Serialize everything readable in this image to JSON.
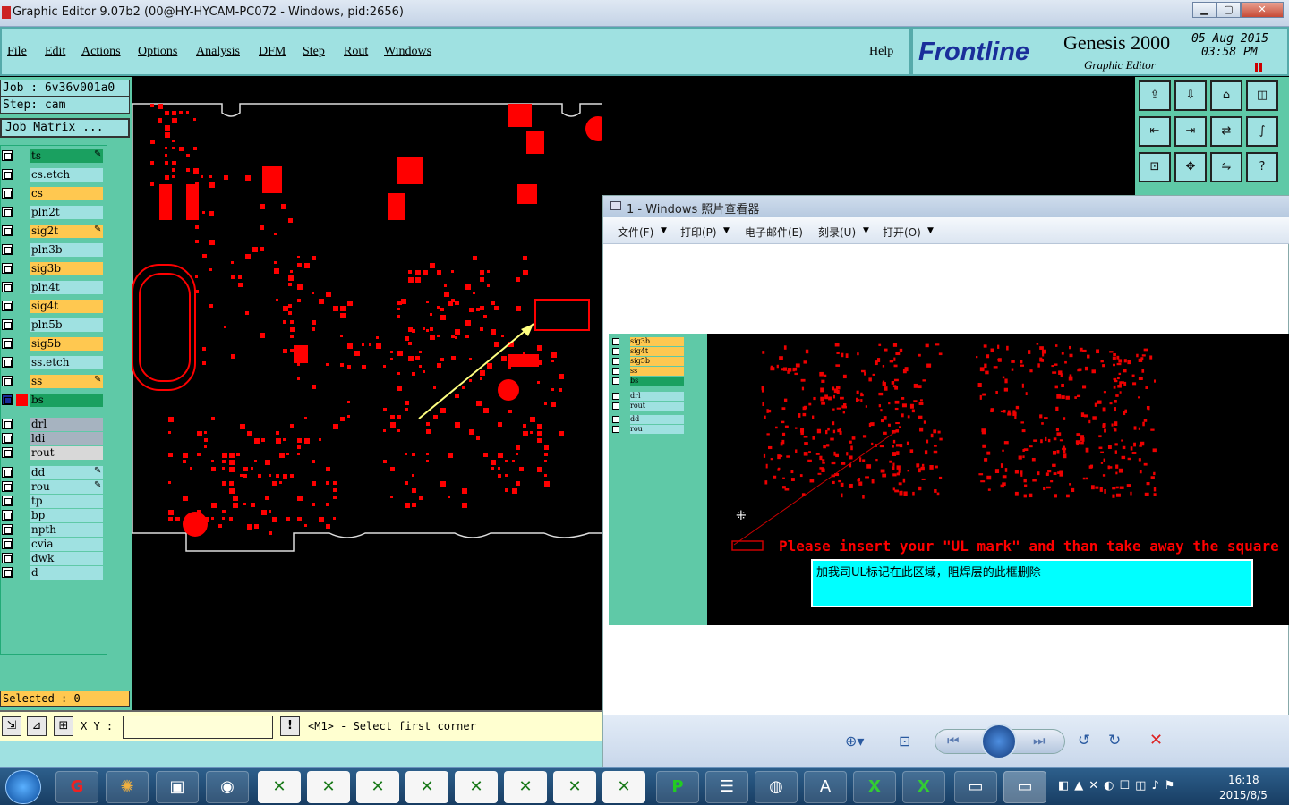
{
  "app": {
    "title": "Graphic Editor 9.07b2 (00@HY-HYCAM-PC072 - Windows, pid:2656)",
    "min": "▁",
    "max": "▢",
    "close": "✕"
  },
  "menu": [
    "File",
    "Edit",
    "Actions",
    "Options",
    "Analysis",
    "DFM",
    "Step",
    "Rout",
    "Windows"
  ],
  "help": "Help",
  "brand": {
    "logo": "Frontline",
    "product": "Genesis 2000",
    "subtitle": "Graphic Editor",
    "date": "05 Aug 2015",
    "time": "03:58 PM"
  },
  "job": {
    "job": "Job : 6v36v001a0",
    "step": "Step: cam",
    "matrix": "Job Matrix ..."
  },
  "layers": [
    {
      "name": "ts",
      "color": "#1aa060",
      "mark": "pencil"
    },
    {
      "name": "cs.etch",
      "color": "#9fe1e1"
    },
    {
      "name": "cs",
      "color": "#ffc850"
    },
    {
      "name": "pln2t",
      "color": "#9fe1e1"
    },
    {
      "name": "sig2t",
      "color": "#ffc850",
      "mark": "pencil"
    },
    {
      "name": "pln3b",
      "color": "#9fe1e1"
    },
    {
      "name": "sig3b",
      "color": "#ffc850"
    },
    {
      "name": "pln4t",
      "color": "#9fe1e1"
    },
    {
      "name": "sig4t",
      "color": "#ffc850"
    },
    {
      "name": "pln5b",
      "color": "#9fe1e1"
    },
    {
      "name": "sig5b",
      "color": "#ffc850"
    },
    {
      "name": "ss.etch",
      "color": "#9fe1e1"
    },
    {
      "name": "ss",
      "color": "#ffc850",
      "mark": "pencil"
    },
    {
      "name": "bs",
      "color": "#1aa060",
      "active": true
    },
    {
      "name": "drl",
      "color": "#a6b3c0"
    },
    {
      "name": "ldi",
      "color": "#a6b3c0"
    },
    {
      "name": "rout",
      "color": "#d8d8d8"
    },
    {
      "name": "dd",
      "color": "#9fe1e1",
      "mark": "pencil"
    },
    {
      "name": "rou",
      "color": "#9fe1e1",
      "mark": "pencil"
    },
    {
      "name": "tp",
      "color": "#9fe1e1"
    },
    {
      "name": "bp",
      "color": "#9fe1e1"
    },
    {
      "name": "npth",
      "color": "#9fe1e1"
    },
    {
      "name": "cvia",
      "color": "#9fe1e1"
    },
    {
      "name": "dwk",
      "color": "#9fe1e1"
    },
    {
      "name": "d",
      "color": "#9fe1e1"
    }
  ],
  "selected": "Selected : 0",
  "coord": {
    "label": "X Y :",
    "value": ""
  },
  "status": "<M1> - Select first corner",
  "viewer": {
    "title": "1 - Windows 照片查看器",
    "menu": [
      "文件(F)",
      "打印(P)",
      "电子邮件(E)",
      "刻录(U)",
      "打开(O)"
    ],
    "layers": [
      "sig3b",
      "sig4t",
      "sig5b",
      "ss",
      "bs",
      "drl",
      "rout",
      "dd",
      "rou"
    ],
    "notice_en": "Please insert your \"UL mark\" and than take away the square",
    "notice_cn": "加我司UL标记在此区域，阻焊层的此框删除"
  },
  "clock": {
    "time": "16:18",
    "date": "2015/8/5"
  },
  "colors": {
    "panel": "#9fe1e1",
    "accent": "#5fc9a7",
    "board": "#ff0000",
    "cyan": "#00ffff"
  }
}
